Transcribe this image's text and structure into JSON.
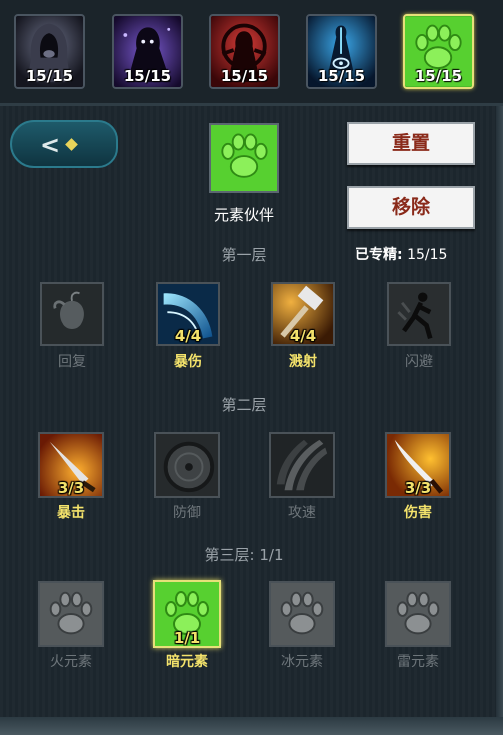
{
  "trees": [
    {
      "icon": "hooded-figure-icon",
      "count": "15/15",
      "active": false
    },
    {
      "icon": "shadow-demon-icon",
      "count": "15/15",
      "active": false
    },
    {
      "icon": "red-summoner-icon",
      "count": "15/15",
      "active": false
    },
    {
      "icon": "blue-spirit-icon",
      "count": "15/15",
      "active": false
    },
    {
      "icon": "green-paw-icon",
      "count": "15/15",
      "active": true
    }
  ],
  "header": {
    "current_name": "元素伙伴",
    "reset_label": "重置",
    "remove_label": "移除",
    "mastered_label": "已专精:",
    "mastered_value": "15/15"
  },
  "layers": {
    "one": {
      "title": "第一层",
      "skills": [
        {
          "name": "回复",
          "count": "",
          "active": false
        },
        {
          "name": "暴伤",
          "count": "4/4",
          "active": true
        },
        {
          "name": "溅射",
          "count": "4/4",
          "active": true
        },
        {
          "name": "闪避",
          "count": "",
          "active": false
        }
      ]
    },
    "two": {
      "title": "第二层",
      "skills": [
        {
          "name": "暴击",
          "count": "3/3",
          "active": true
        },
        {
          "name": "防御",
          "count": "",
          "active": false
        },
        {
          "name": "攻速",
          "count": "",
          "active": false
        },
        {
          "name": "伤害",
          "count": "3/3",
          "active": true
        }
      ]
    },
    "three": {
      "title": "第三层:",
      "progress": "1/1",
      "skills": [
        {
          "name": "火元素",
          "count": "",
          "active": false
        },
        {
          "name": "暗元素",
          "count": "1/1",
          "active": true
        },
        {
          "name": "冰元素",
          "count": "",
          "active": false
        },
        {
          "name": "雷元素",
          "count": "",
          "active": false
        }
      ]
    }
  },
  "colors": {
    "accent_yellow": "#f3e26b",
    "paw_green": "#5fd43a",
    "button_text": "#8a2a1a",
    "inactive_text": "#6e767b"
  }
}
